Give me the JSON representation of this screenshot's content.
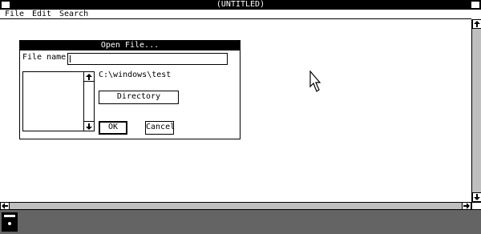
{
  "window": {
    "title": "(UNTITLED)",
    "menu": [
      "File",
      "Edit",
      "Search"
    ]
  },
  "dialog": {
    "title": "Open File...",
    "filename_label": "File name:",
    "filename_value": "",
    "current_dir": "C:\\windows\\test",
    "directory_button": "Directory",
    "ok_button": "OK",
    "cancel_button": "Cancel",
    "file_list": []
  },
  "icons": {
    "up": "arrow-up-icon",
    "down": "arrow-down-icon",
    "left": "arrow-left-icon",
    "right": "arrow-right-icon",
    "cursor": "mouse-pointer-icon",
    "drive": "disk-drive-icon"
  },
  "colors": {
    "foreground": "#000000",
    "background": "#ffffff",
    "desktop": "#8a8a8a"
  }
}
